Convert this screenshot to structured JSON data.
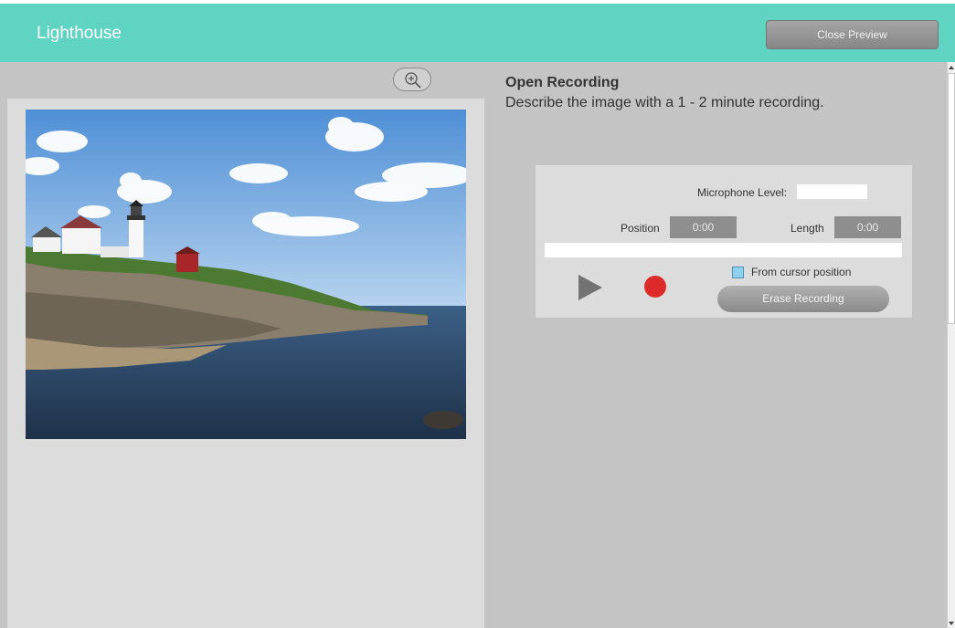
{
  "header": {
    "title": "Lighthouse",
    "close_label": "Close Preview"
  },
  "image_panel": {
    "zoom_icon": "zoom-in-icon",
    "photo_subject": "lighthouse"
  },
  "recording": {
    "title": "Open Recording",
    "description": "Describe the image with a 1 - 2 minute recording.",
    "mic_label": "Microphone Level:",
    "position_label": "Position",
    "position_value": "0:00",
    "length_label": "Length",
    "length_value": "0:00",
    "from_cursor_label": "From cursor position",
    "erase_label": "Erase Recording",
    "play_icon": "play-icon",
    "record_icon": "record-icon"
  },
  "colors": {
    "header_bg": "#5fd4c3",
    "record": "#dd2b2b",
    "checkbox": "#8fd0ee"
  }
}
